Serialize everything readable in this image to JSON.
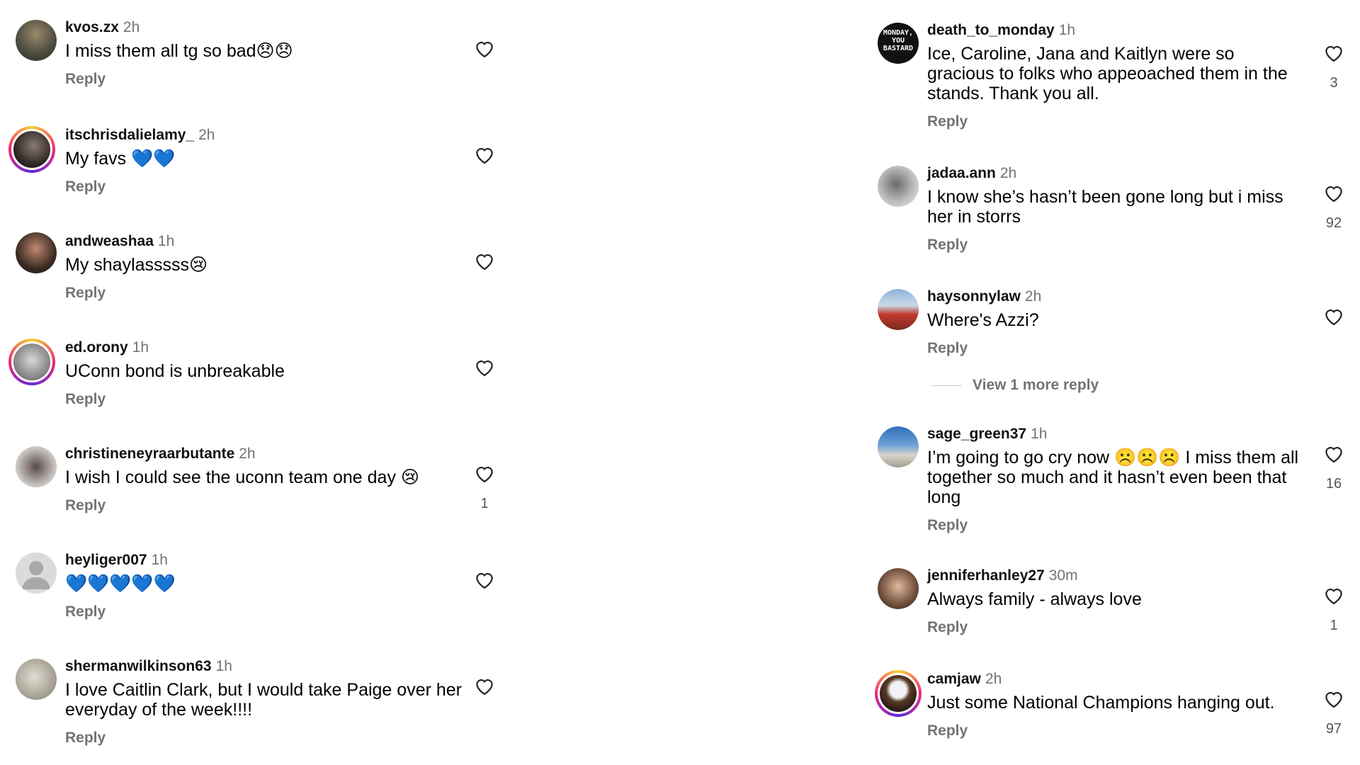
{
  "left": [
    {
      "user": "kvos.zx",
      "time": "2h",
      "text": "I miss them all tg so bad😞😞",
      "reply": "Reply",
      "likes": ""
    },
    {
      "user": "itschrisdalielamy_",
      "time": "2h",
      "text": "My favs 💙💙",
      "reply": "Reply",
      "likes": ""
    },
    {
      "user": "andweashaa",
      "time": "1h",
      "text": "My shaylasssss😢",
      "reply": "Reply",
      "likes": ""
    },
    {
      "user": "ed.orony",
      "time": "1h",
      "text": "UConn bond is unbreakable",
      "reply": "Reply",
      "likes": ""
    },
    {
      "user": "christineneyraarbutante",
      "time": "2h",
      "text": "I wish I could see the uconn team one day 😢",
      "reply": "Reply",
      "likes": "1"
    },
    {
      "user": "heyliger007",
      "time": "1h",
      "text": "💙💙💙💙💙",
      "reply": "Reply",
      "likes": ""
    },
    {
      "user": "shermanwilkinson63",
      "time": "1h",
      "text": "I love Caitlin Clark, but I would take Paige over her everyday of the week!!!!",
      "reply": "Reply",
      "likes": ""
    }
  ],
  "right": [
    {
      "user": "death_to_monday",
      "time": "1h",
      "text": "Ice, Caroline, Jana and Kaitlyn were so gracious to folks who appeoached them in the stands. Thank you all.",
      "reply": "Reply",
      "likes": "3",
      "avatar_text": "MONDAY, YOU BASTARD"
    },
    {
      "user": "jadaa.ann",
      "time": "2h",
      "text": "I know she’s hasn’t been gone long but i miss her in storrs",
      "reply": "Reply",
      "likes": "92"
    },
    {
      "user": "haysonnylaw",
      "time": "2h",
      "text": "Where's Azzi?",
      "reply": "Reply",
      "likes": ""
    },
    {
      "user": "sage_green37",
      "time": "1h",
      "text": "I’m going to go cry now ☹️☹️☹️ I miss them all together so much and it hasn’t even been that long",
      "reply": "Reply",
      "likes": "16"
    },
    {
      "user": "jenniferhanley27",
      "time": "30m",
      "text": "Always family - always love",
      "reply": "Reply",
      "likes": "1"
    },
    {
      "user": "camjaw",
      "time": "2h",
      "text": "Just some National Champions hanging out.",
      "reply": "Reply",
      "likes": "97"
    }
  ],
  "view_more_reply": "View 1 more reply",
  "icons": {
    "like": "heart-outline-icon",
    "avatar_placeholder": "person-silhouette-icon"
  },
  "colors": {
    "username": "#111111",
    "muted": "#737373",
    "ring_start": "#f9ce34",
    "ring_mid": "#ee2a7b",
    "ring_end": "#6228d7"
  }
}
